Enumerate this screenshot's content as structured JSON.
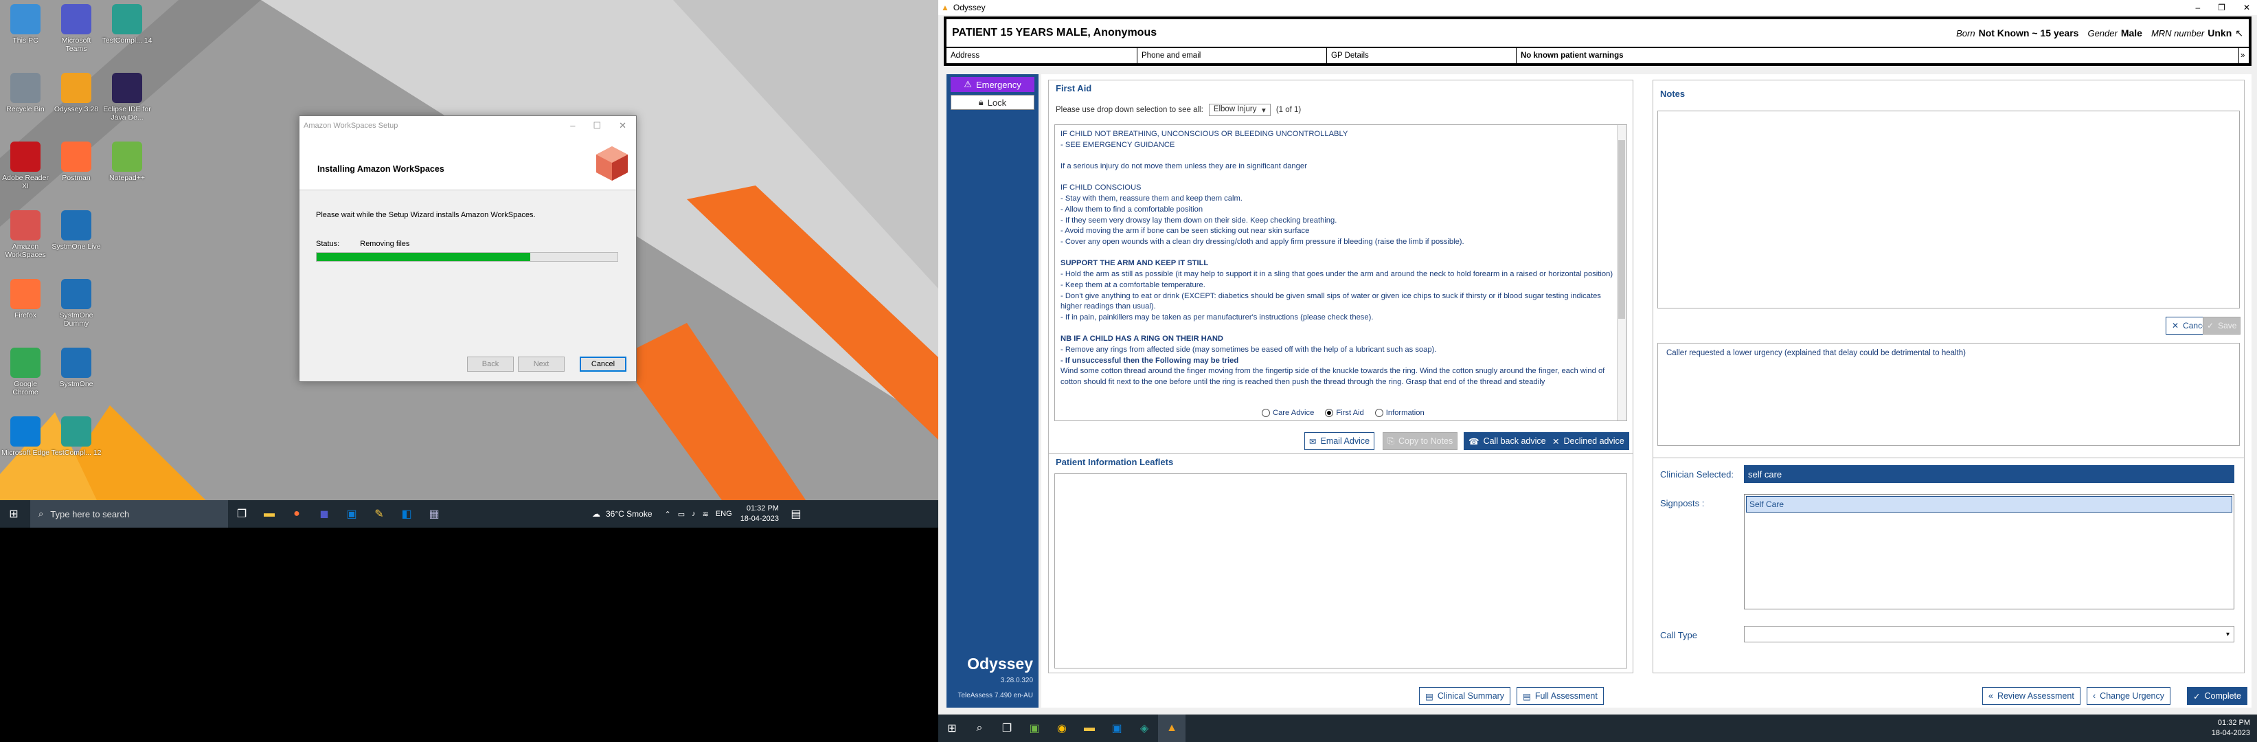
{
  "left_screen": {
    "desktop_icons": [
      {
        "label": "This PC",
        "icon": "computer-icon",
        "color": "#3b8fd6"
      },
      {
        "label": "Microsoft Teams",
        "icon": "teams-icon",
        "color": "#5059c9"
      },
      {
        "label": "TestCompl... 14",
        "icon": "testcomplete-icon",
        "color": "#2a9d8f"
      },
      {
        "label": "Recycle Bin",
        "icon": "recycle-bin-icon",
        "color": "#7d8a96"
      },
      {
        "label": "Odyssey 3.28",
        "icon": "odyssey-icon",
        "color": "#f0a020"
      },
      {
        "label": "Eclipse IDE for Java De...",
        "icon": "eclipse-icon",
        "color": "#2c2255"
      },
      {
        "label": "Adobe Reader XI",
        "icon": "adobe-icon",
        "color": "#c4161c"
      },
      {
        "label": "Postman",
        "icon": "postman-icon",
        "color": "#ff6c37"
      },
      {
        "label": "Notepad++",
        "icon": "notepadpp-icon",
        "color": "#6fb545"
      },
      {
        "label": "Amazon WorkSpaces",
        "icon": "workspaces-icon",
        "color": "#d9534f"
      },
      {
        "label": "SystmOne Live",
        "icon": "systmone-icon",
        "color": "#1f6fb5"
      },
      {
        "label": "Firefox",
        "icon": "firefox-icon",
        "color": "#ff7139"
      },
      {
        "label": "SystmOne Dummy",
        "icon": "systmone-icon",
        "color": "#1f6fb5"
      },
      {
        "label": "Google Chrome",
        "icon": "chrome-icon",
        "color": "#34a853"
      },
      {
        "label": "SystmOne",
        "icon": "systmone-icon",
        "color": "#1f6fb5"
      },
      {
        "label": "Microsoft Edge",
        "icon": "edge-icon",
        "color": "#0c7cd5"
      },
      {
        "label": "TestCompl... 12",
        "icon": "testcomplete-icon",
        "color": "#2a9d8f"
      }
    ],
    "setup_dialog": {
      "title": "Amazon WorkSpaces Setup",
      "heading": "Installing Amazon WorkSpaces",
      "message": "Please wait while the Setup Wizard installs Amazon WorkSpaces.",
      "status_label": "Status:",
      "status_value": "Removing files",
      "progress": 0.71,
      "back": "Back",
      "next": "Next",
      "cancel": "Cancel"
    },
    "taskbar": {
      "search_placeholder": "Type here to search",
      "weather": "36°C  Smoke",
      "lang": "ENG",
      "time": "01:32 PM",
      "date": "18-04-2023"
    }
  },
  "odyssey": {
    "window_title": "Odyssey",
    "patient": {
      "name": "PATIENT 15 YEARS MALE, Anonymous",
      "born_label": "Born",
      "born_value": "Not Known ~ 15 years",
      "gender_label": "Gender",
      "gender_value": "Male",
      "mrn_label": "MRN number",
      "mrn_value": "Unkn",
      "address": "Address",
      "phone": "Phone and email",
      "gp": "GP Details",
      "warnings": "No known patient warnings"
    },
    "sidebar": {
      "emergency": "Emergency",
      "lock": "Lock",
      "brand": "Odyssey",
      "version": "3.28.0.320",
      "teleassess": "TeleAssess 7.490 en-AU"
    },
    "first_aid": {
      "title": "First Aid",
      "dropdown_prompt": "Please use drop down selection to see all:",
      "dropdown_value": "Elbow Injury",
      "count": "(1 of 1)",
      "lines": [
        {
          "t": "IF CHILD NOT BREATHING, UNCONSCIOUS OR BLEEDING UNCONTROLLABLY",
          "b": false
        },
        {
          "t": "- SEE EMERGENCY GUIDANCE",
          "b": false
        },
        {
          "t": "",
          "b": false
        },
        {
          "t": "If a serious injury do not move them unless they are in significant danger",
          "b": false
        },
        {
          "t": "",
          "b": false
        },
        {
          "t": "IF CHILD CONSCIOUS",
          "b": false
        },
        {
          "t": "- Stay with them, reassure them and keep them calm.",
          "b": false
        },
        {
          "t": "- Allow them to find a comfortable position",
          "b": false
        },
        {
          "t": "- If they seem very drowsy lay them down on their side. Keep checking breathing.",
          "b": false
        },
        {
          "t": "- Avoid moving the arm if bone can be seen sticking out near skin surface",
          "b": false
        },
        {
          "t": "- Cover any open wounds with a clean dry dressing/cloth and apply firm pressure if bleeding (raise the limb if possible).",
          "b": false
        },
        {
          "t": "",
          "b": false
        },
        {
          "t": "SUPPORT THE ARM AND KEEP IT STILL",
          "b": true
        },
        {
          "t": "- Hold the arm as still as possible (it may help to support it in a sling that goes under the arm and around the neck to hold forearm in a raised or horizontal position)",
          "b": false
        },
        {
          "t": "- Keep them at a comfortable temperature.",
          "b": false
        },
        {
          "t": "- Don't give anything to eat or drink (EXCEPT: diabetics should be given small sips of water or given ice chips to suck if thirsty or if blood sugar testing indicates higher readings than usual).",
          "b": false
        },
        {
          "t": "- If in pain, painkillers may be taken as per manufacturer's instructions (please check these).",
          "b": false
        },
        {
          "t": "",
          "b": false
        },
        {
          "t": "NB IF A CHILD HAS A RING ON THEIR HAND",
          "b": true
        },
        {
          "t": "- Remove any rings from affected side (may sometimes be eased off with the help of a lubricant such as soap).",
          "b": false
        },
        {
          "t": "- If unsuccessful then the Following may be tried",
          "b": true
        },
        {
          "t": "Wind some cotton thread around the finger moving from the fingertip side of the knuckle towards the ring. Wind the cotton snugly around the finger, each wind of cotton should fit next to the one before until the ring is reached then push the thread through the ring. Grasp that end of the thread and steadily",
          "b": false
        }
      ],
      "radio_care": "Care Advice",
      "radio_first_aid": "First Aid",
      "radio_info": "Information",
      "email_advice": "Email Advice",
      "copy_notes": "Copy to Notes",
      "call_back": "Call back advice",
      "declined": "Declined advice"
    },
    "leaflets": {
      "title": "Patient Information Leaflets"
    },
    "notes": {
      "title": "Notes",
      "cancel": "Cancel",
      "save": "Save",
      "note_text": "Caller requested a lower urgency (explained that delay could be detrimental to health)"
    },
    "clinician": {
      "selected_label": "Clinician Selected:",
      "selected_value": "self care",
      "signposts_label": "Signposts :",
      "signpost_item": "Self Care",
      "call_type_label": "Call Type"
    },
    "bottom_buttons": {
      "clinical_summary": "Clinical Summary",
      "full_assessment": "Full Assessment",
      "review": "Review Assessment",
      "change_urgency": "Change Urgency",
      "complete": "Complete"
    },
    "taskbar": {
      "time": "01:32 PM",
      "date": "18-04-2023"
    }
  }
}
